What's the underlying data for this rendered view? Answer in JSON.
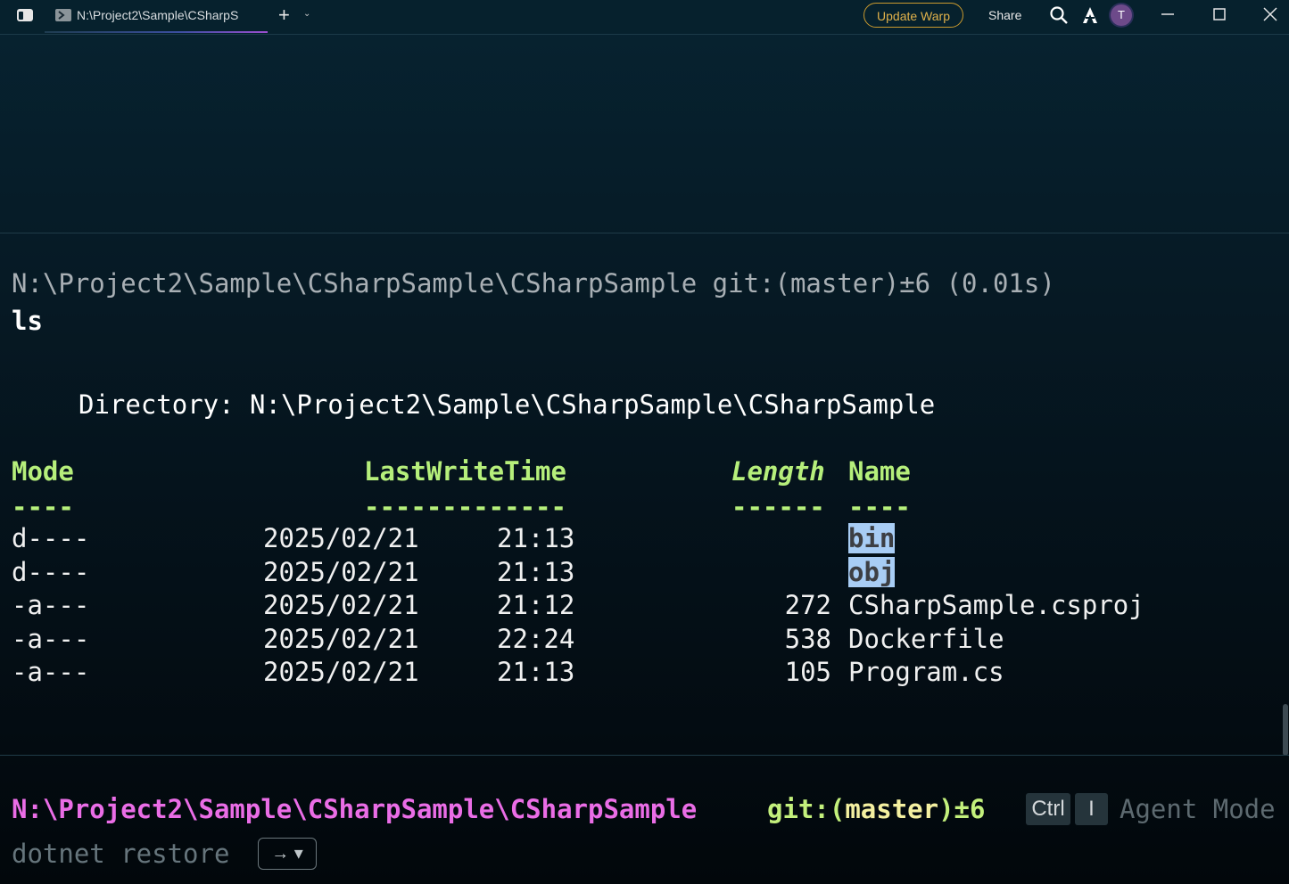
{
  "titlebar": {
    "tab_title": "N:\\Project2\\Sample\\CSharpS",
    "new_tab_label": "+",
    "new_tab_menu_label": "⌄",
    "update_label": "Update Warp",
    "share_label": "Share",
    "avatar_initial": "T",
    "icons": [
      "sidebar-toggle-icon",
      "terminal-icon",
      "search-icon",
      "warp-logo-icon",
      "minimize-icon",
      "maximize-icon",
      "close-icon"
    ]
  },
  "block": {
    "prompt": "N:\\Project2\\Sample\\CSharpSample\\CSharpSample git:(master)±6 (0.01s)",
    "command": "ls",
    "directory_line": "Directory: N:\\Project2\\Sample\\CSharpSample\\CSharpSample",
    "headers": {
      "mode": "Mode",
      "time": "LastWriteTime",
      "length": "Length",
      "name": "Name"
    },
    "separators": {
      "mode": "----",
      "time": "-------------",
      "length": "------",
      "name": "----"
    },
    "rows": [
      {
        "mode": "d----",
        "date": "2025/02/21",
        "time": "21:13",
        "length": "",
        "name": "bin",
        "highlighted": true
      },
      {
        "mode": "d----",
        "date": "2025/02/21",
        "time": "21:13",
        "length": "",
        "name": "obj",
        "highlighted": true
      },
      {
        "mode": "-a---",
        "date": "2025/02/21",
        "time": "21:12",
        "length": "272",
        "name": "CSharpSample.csproj",
        "highlighted": false
      },
      {
        "mode": "-a---",
        "date": "2025/02/21",
        "time": "22:24",
        "length": "538",
        "name": "Dockerfile",
        "highlighted": false
      },
      {
        "mode": "-a---",
        "date": "2025/02/21",
        "time": "21:13",
        "length": "105",
        "name": "Program.cs",
        "highlighted": false
      }
    ]
  },
  "input": {
    "path": "N:\\Project2\\Sample\\CSharpSample\\CSharpSample",
    "git_prefix": "git:(",
    "git_branch": "master",
    "git_suffix": ")±6",
    "kbd_ctrl": "Ctrl",
    "kbd_i": "I",
    "agent_mode_hint": "Agent Mode",
    "suggestion": "dotnet restore",
    "accept_hint": "→ ▾"
  },
  "colors": {
    "background_top": "#072331",
    "background_bottom": "#02070b",
    "header_green": "#b6ef7b",
    "prompt_magenta": "#ea6de6",
    "selection": "#a8cdf5",
    "update_gold": "#c99a2e"
  }
}
